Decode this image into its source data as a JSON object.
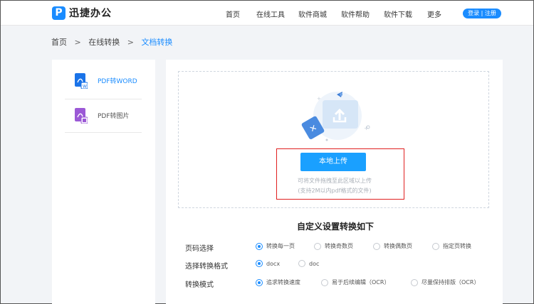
{
  "header": {
    "logo_mark": "P",
    "logo_text": "迅捷办公",
    "nav": [
      "首页",
      "在线工具",
      "软件商城",
      "软件帮助",
      "软件下载",
      "更多"
    ],
    "login_label": "登录 | 注册"
  },
  "breadcrumb": {
    "home": "首页",
    "level2": "在线转换",
    "current": "文档转换",
    "separator": ">"
  },
  "sidebar": {
    "items": [
      {
        "label": "PDF转WORD",
        "active": true,
        "icon": "pdf-to-word-icon"
      },
      {
        "label": "PDF转图片",
        "active": false,
        "icon": "pdf-to-image-icon"
      }
    ]
  },
  "upload": {
    "button_label": "本地上传",
    "hint_line1": "可将文件拖拽至此区域以上传",
    "hint_line2": "(支持2M以内pdf格式的文件)"
  },
  "settings": {
    "title": "自定义设置转换如下",
    "rows": [
      {
        "label": "页码选择",
        "options": [
          "转换每一页",
          "转换奇数页",
          "转换偶数页",
          "指定页转换"
        ],
        "selected": 0
      },
      {
        "label": "选择转换格式",
        "options": [
          "docx",
          "doc"
        ],
        "selected": 0
      },
      {
        "label": "转换模式",
        "options": [
          "追求转换速度",
          "易于后续编辑（OCR）",
          "尽量保持排版（OCR）"
        ],
        "selected": 0
      }
    ]
  },
  "colors": {
    "accent": "#1a8cff",
    "highlight": "#e02020",
    "word_icon": "#1a73e8",
    "image_icon": "#9b59d6"
  }
}
